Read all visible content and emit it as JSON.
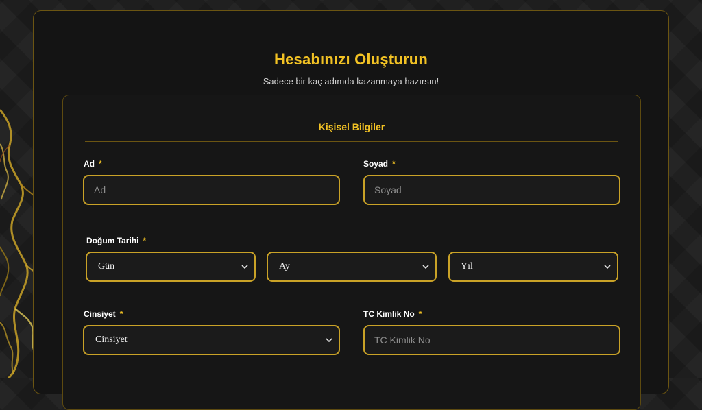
{
  "header": {
    "title": "Hesabınızı Oluşturun",
    "subtitle": "Sadece bir kaç adımda kazanmaya hazırsın!"
  },
  "section": {
    "title": "Kişisel Bilgiler"
  },
  "fields": {
    "first_name": {
      "label": "Ad",
      "required": "*",
      "placeholder": "Ad",
      "value": ""
    },
    "last_name": {
      "label": "Soyad",
      "required": "*",
      "placeholder": "Soyad",
      "value": ""
    },
    "birth_date": {
      "label": "Doğum Tarihi",
      "required": "*",
      "day": "Gün",
      "month": "Ay",
      "year": "Yıl"
    },
    "gender": {
      "label": "Cinsiyet",
      "required": "*",
      "value": "Cinsiyet"
    },
    "tc_id": {
      "label": "TC Kimlik No",
      "required": "*",
      "placeholder": "TC Kimlik No",
      "value": ""
    }
  },
  "icons": {
    "select_arrow": "chevron-down-icon"
  },
  "colors": {
    "accent": "#f2c224",
    "border": "#c9a227",
    "background": "#141414",
    "page_background": "#1c1c1c"
  }
}
